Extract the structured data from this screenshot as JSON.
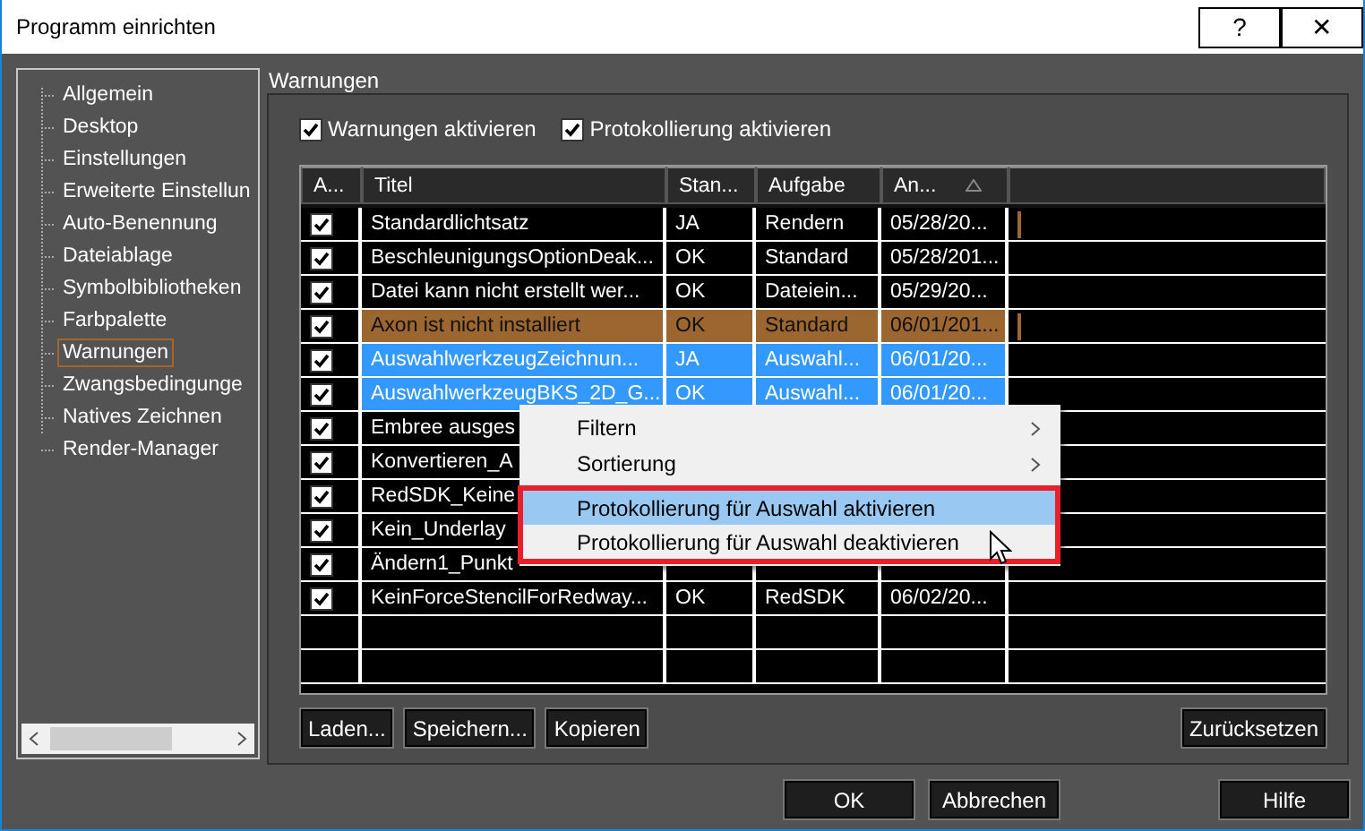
{
  "window": {
    "title": "Programm einrichten",
    "help": "?",
    "close": "✕"
  },
  "sidebar": {
    "items": [
      {
        "label": "Allgemein",
        "selected": false
      },
      {
        "label": "Desktop",
        "selected": false
      },
      {
        "label": "Einstellungen",
        "selected": false
      },
      {
        "label": "Erweiterte Einstellun",
        "selected": false
      },
      {
        "label": "Auto-Benennung",
        "selected": false
      },
      {
        "label": "Dateiablage",
        "selected": false
      },
      {
        "label": "Symbolbibliotheken",
        "selected": false
      },
      {
        "label": "Farbpalette",
        "selected": false
      },
      {
        "label": "Warnungen",
        "selected": true
      },
      {
        "label": "Zwangsbedingunge",
        "selected": false
      },
      {
        "label": "Natives Zeichnen",
        "selected": false
      },
      {
        "label": "Render-Manager",
        "selected": false
      }
    ]
  },
  "section": {
    "title": "Warnungen"
  },
  "options": [
    {
      "label": "Warnungen aktivieren",
      "checked": true
    },
    {
      "label": "Protokollierung aktivieren",
      "checked": true
    }
  ],
  "table": {
    "columns": [
      {
        "label": "A..."
      },
      {
        "label": "Titel"
      },
      {
        "label": "Stan..."
      },
      {
        "label": "Aufgabe"
      },
      {
        "label": "An...",
        "sorted": true
      }
    ],
    "rows": [
      {
        "checked": true,
        "selected": false,
        "marked": false,
        "flag": true,
        "cells": [
          "",
          "Standardlichtsatz",
          "JA",
          "Rendern",
          "05/28/20..."
        ]
      },
      {
        "checked": true,
        "selected": false,
        "marked": false,
        "flag": false,
        "cells": [
          "",
          "BeschleunigungsOptionDeak...",
          "OK",
          "Standard",
          "05/28/201..."
        ]
      },
      {
        "checked": true,
        "selected": false,
        "marked": false,
        "flag": false,
        "cells": [
          "",
          "Datei kann nicht erstellt wer...",
          "OK",
          "Dateiein...",
          "05/29/20..."
        ]
      },
      {
        "checked": true,
        "selected": false,
        "marked": true,
        "flag": true,
        "cells": [
          "",
          "Axon ist nicht installiert",
          "OK",
          "Standard",
          "06/01/201..."
        ]
      },
      {
        "checked": true,
        "selected": true,
        "marked": false,
        "flag": false,
        "cells": [
          "",
          "AuswahlwerkzeugZeichnun...",
          "JA",
          "Auswahl...",
          "06/01/20..."
        ]
      },
      {
        "checked": true,
        "selected": true,
        "marked": false,
        "flag": false,
        "cells": [
          "",
          "AuswahlwerkzeugBKS_2D_G...",
          "OK",
          "Auswahl...",
          "06/01/20..."
        ]
      },
      {
        "checked": true,
        "selected": false,
        "marked": false,
        "flag": false,
        "cells": [
          "",
          "Embree ausges"
        ]
      },
      {
        "checked": true,
        "selected": false,
        "marked": false,
        "flag": false,
        "cells": [
          "",
          "Konvertieren_A"
        ]
      },
      {
        "checked": true,
        "selected": false,
        "marked": false,
        "flag": false,
        "cells": [
          "",
          "RedSDK_Keine"
        ]
      },
      {
        "checked": true,
        "selected": false,
        "marked": false,
        "flag": false,
        "cells": [
          "",
          "Kein_Underlay"
        ]
      },
      {
        "checked": true,
        "selected": false,
        "marked": false,
        "flag": false,
        "cells": [
          "",
          "Ändern1_Punkt"
        ]
      },
      {
        "checked": true,
        "selected": false,
        "marked": false,
        "flag": false,
        "cells": [
          "",
          "KeinForceStencilForRedway...",
          "OK",
          "RedSDK",
          "06/02/20..."
        ]
      }
    ]
  },
  "table_buttons": [
    {
      "label": "Laden..."
    },
    {
      "label": "Speichern..."
    },
    {
      "label": "Kopieren"
    }
  ],
  "reset_button": {
    "label": "Zurücksetzen"
  },
  "context_menu": {
    "items": [
      {
        "label": "Filtern",
        "submenu": true,
        "selected": false,
        "in_callout": false
      },
      {
        "label": "Sortierung",
        "submenu": true,
        "selected": false,
        "in_callout": false
      },
      {
        "label": "Protokollierung für Auswahl aktivieren",
        "submenu": false,
        "selected": true,
        "in_callout": true
      },
      {
        "label": "Protokollierung für Auswahl deaktivieren",
        "submenu": false,
        "selected": false,
        "in_callout": true
      }
    ]
  },
  "footer_buttons": [
    {
      "label": "OK"
    },
    {
      "label": "Abbrechen"
    },
    {
      "label": "Hilfe"
    }
  ]
}
